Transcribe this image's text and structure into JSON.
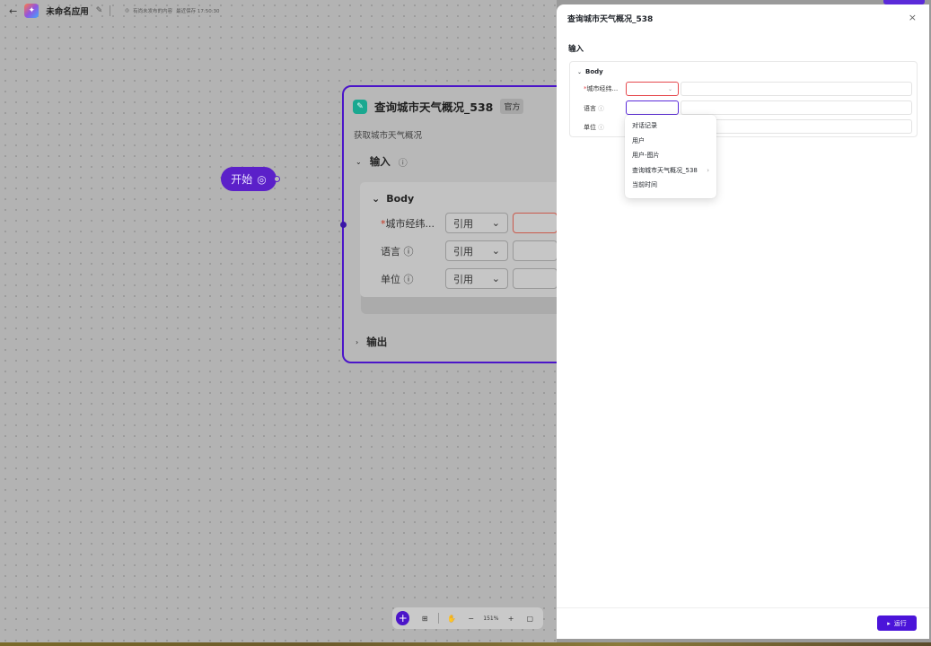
{
  "topbar": {
    "back_icon": "←",
    "app_name": "未命名应用",
    "edit_icon": "✎",
    "unsaved_text": "有尚未发布的内容",
    "last_saved": "最近保存 17:50:30"
  },
  "canvas": {
    "start_node": {
      "label": "开始"
    },
    "node": {
      "title": "查询城市天气概况_538",
      "badge": "官方",
      "description": "获取城市天气概况",
      "input_section": "输入",
      "body_label": "Body",
      "params": [
        {
          "label": "城市经纬...",
          "required": "*",
          "type": "引用"
        },
        {
          "label": "语言",
          "required": "",
          "type": "引用"
        },
        {
          "label": "单位",
          "required": "",
          "type": "引用"
        }
      ],
      "output_section": "输出"
    },
    "toolbar": {
      "zoom": "151%",
      "minus": "−",
      "plus": "+"
    }
  },
  "panel": {
    "title": "查询城市天气概况_538",
    "close_icon": "×",
    "section": "输入",
    "body_label": "Body",
    "params": [
      {
        "label": "城市经纬...",
        "required": "*"
      },
      {
        "label": "语言",
        "required": ""
      },
      {
        "label": "单位",
        "required": ""
      }
    ],
    "dropdown_items": [
      {
        "label": "对话记录",
        "has_submenu": false
      },
      {
        "label": "用户",
        "has_submenu": false
      },
      {
        "label": "用户-图片",
        "has_submenu": false
      },
      {
        "label": "查询城市天气概况_538",
        "has_submenu": true
      },
      {
        "label": "当前时间",
        "has_submenu": false
      }
    ],
    "run_label": "运行"
  },
  "colors": {
    "accent": "#4b14d9",
    "error": "#e5484d",
    "node_icon": "#1aa890"
  }
}
